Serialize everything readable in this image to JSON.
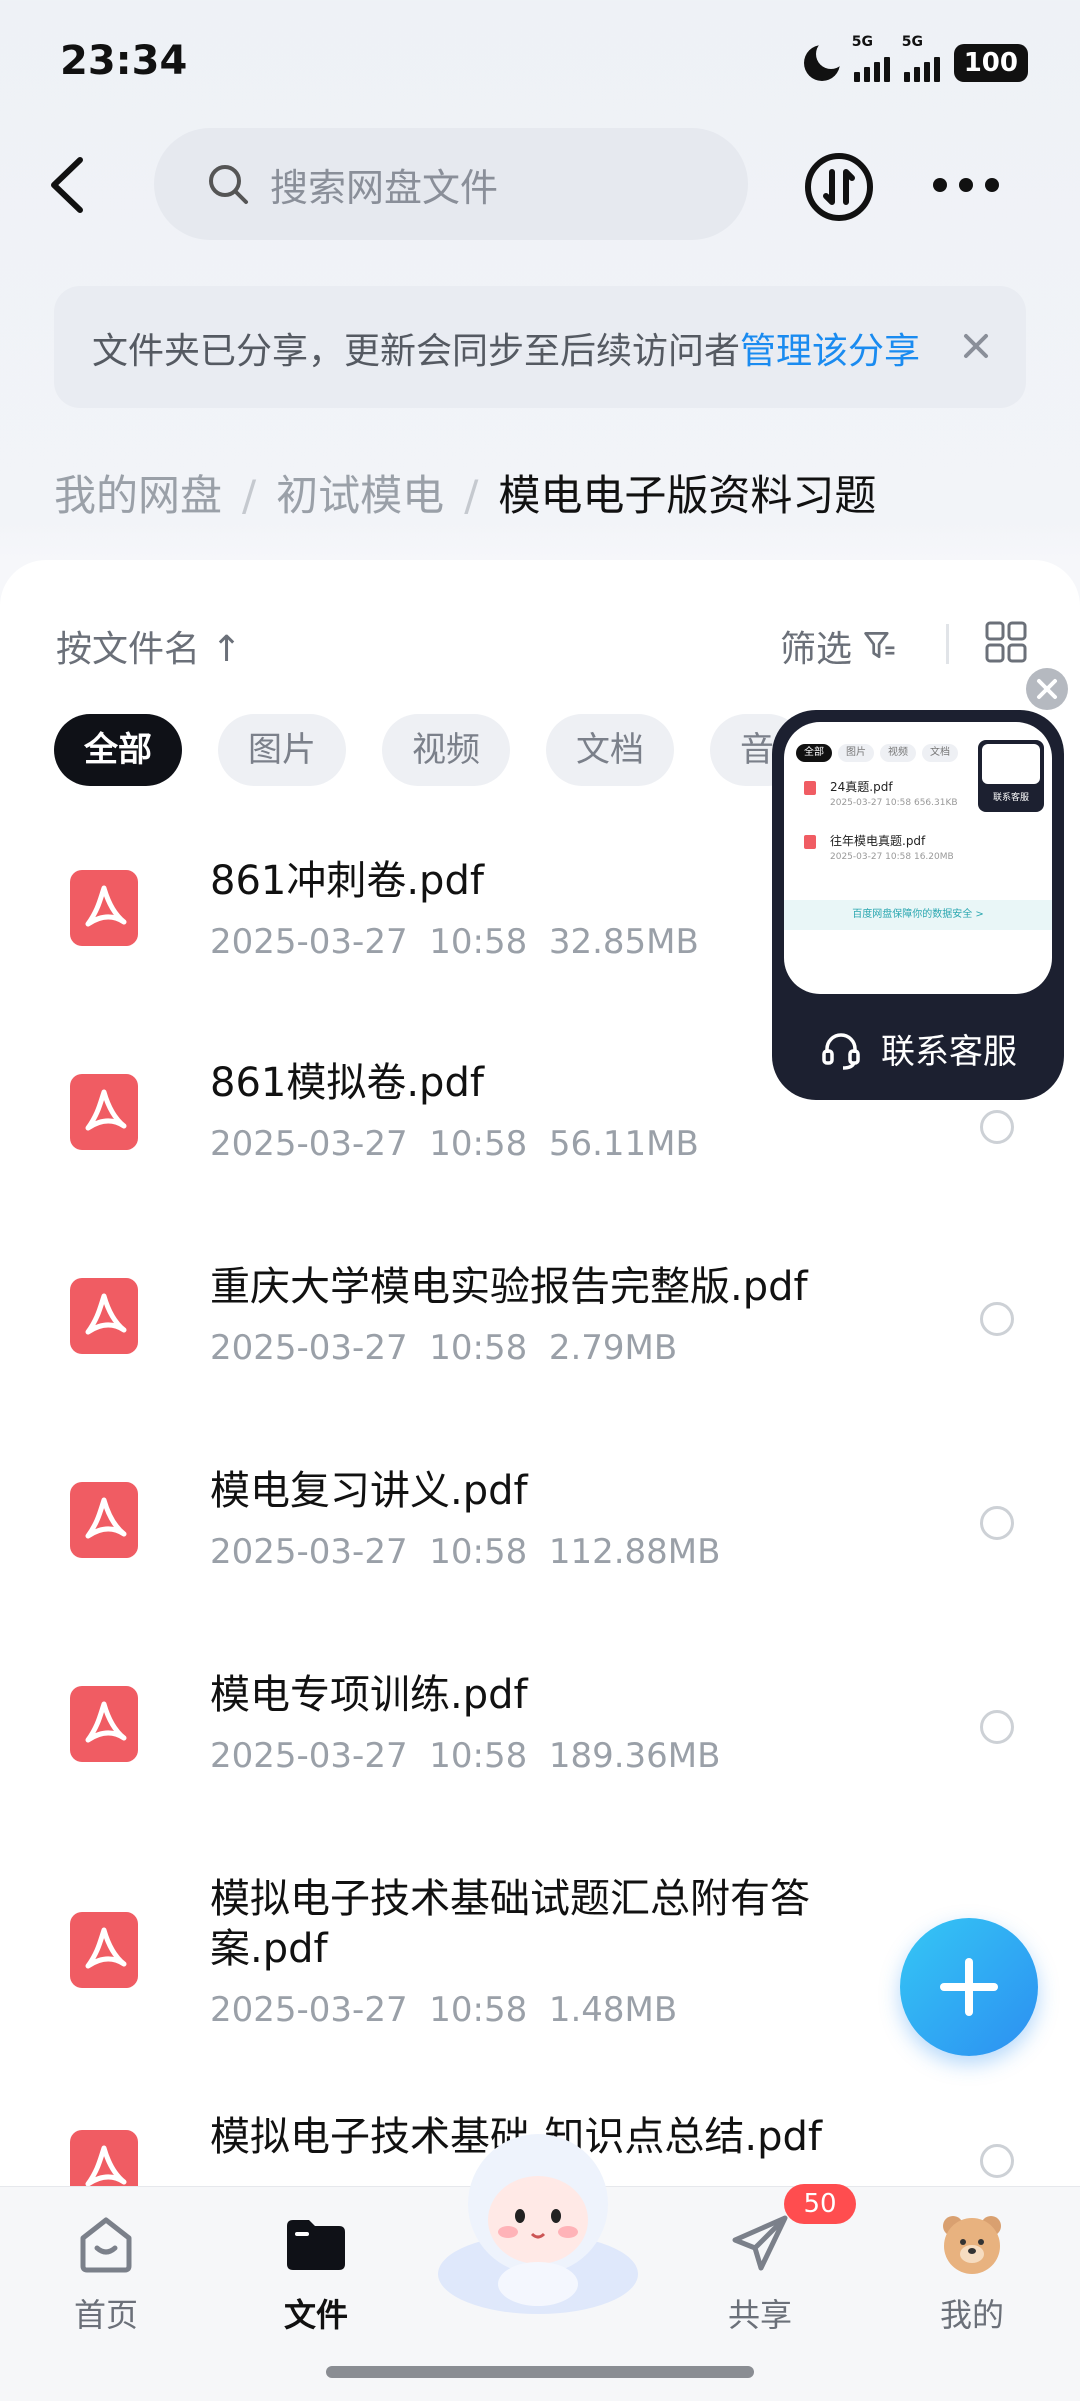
{
  "status_bar": {
    "time": "23:34",
    "signal1": "5G",
    "signal2": "5G",
    "battery": "100"
  },
  "search": {
    "placeholder": "搜索网盘文件"
  },
  "banner": {
    "text": "文件夹已分享，更新会同步至后续访问者",
    "link": "管理该分享"
  },
  "breadcrumb": {
    "root": "我的网盘",
    "parent": "初试模电",
    "current": "模电电子版资料习题",
    "separator": "/"
  },
  "toolbar": {
    "sort_label": "按文件名 ↑",
    "filter_label": "筛选"
  },
  "chips": [
    "全部",
    "图片",
    "视频",
    "文档",
    "音"
  ],
  "files": [
    {
      "name": "861冲刺卷.pdf",
      "date": "2025-03-27",
      "time": "10:58",
      "size": "32.85MB"
    },
    {
      "name": "861模拟卷.pdf",
      "date": "2025-03-27",
      "time": "10:58",
      "size": "56.11MB"
    },
    {
      "name": "重庆大学模电实验报告完整版.pdf",
      "date": "2025-03-27",
      "time": "10:58",
      "size": "2.79MB"
    },
    {
      "name": "模电复习讲义.pdf",
      "date": "2025-03-27",
      "time": "10:58",
      "size": "112.88MB"
    },
    {
      "name": "模电专项训练.pdf",
      "date": "2025-03-27",
      "time": "10:58",
      "size": "189.36MB"
    },
    {
      "name": "模拟电子技术基础试题汇总附有答案.pdf",
      "date": "2025-03-27",
      "time": "10:58",
      "size": "1.48MB"
    },
    {
      "name": "模拟电子技术基础-知识点总结.pdf",
      "date": "",
      "time": "",
      "size": ""
    }
  ],
  "service_window": {
    "label": "联系客服",
    "mini_chips": [
      "全部",
      "图片",
      "视频",
      "文档"
    ],
    "mini_files": [
      {
        "name": "24真题.pdf",
        "meta": "2025-03-27  10:58  656.31KB"
      },
      {
        "name": "往年模电真题.pdf",
        "meta": "2025-03-27  10:58  16.20MB"
      }
    ],
    "mini_bar": "百度网盘保障你的数据安全 >",
    "mini_service": "联系客服"
  },
  "tabbar": {
    "home": "首页",
    "files": "文件",
    "share": "共享",
    "share_badge": "50",
    "mine": "我的"
  },
  "colors": {
    "accent": "#1a8bf0",
    "pdf": "#f05c63",
    "badge": "#ff4d4f",
    "fab": "#2c8ff2"
  }
}
